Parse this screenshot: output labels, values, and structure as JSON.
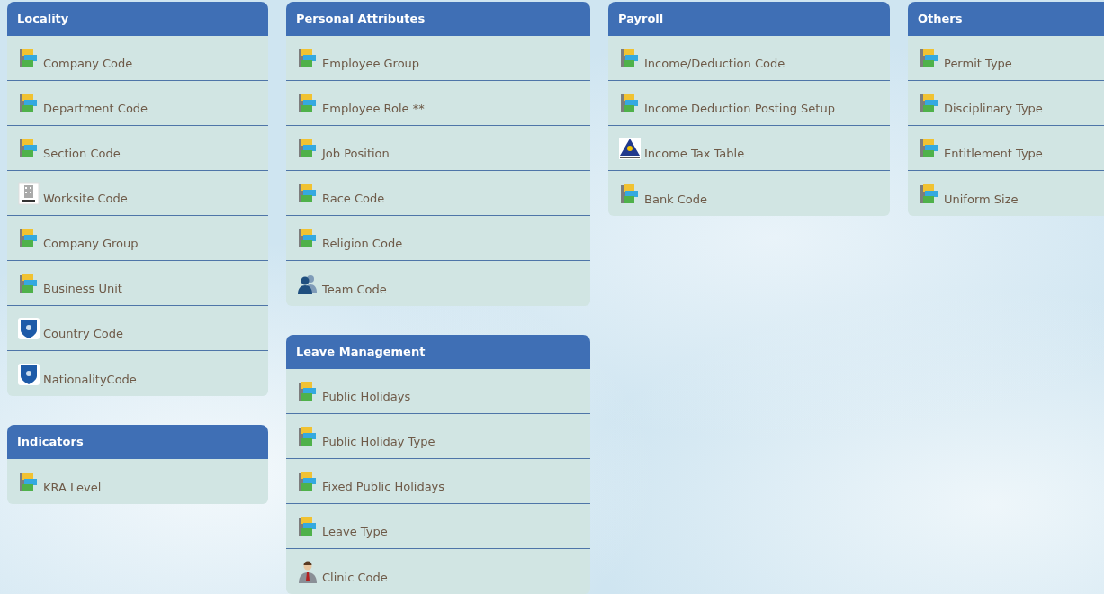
{
  "columns": [
    {
      "sections": [
        {
          "title": "Locality",
          "items": [
            {
              "label": "Company Code",
              "kind": "cabinet"
            },
            {
              "label": "Department Code",
              "kind": "cabinet"
            },
            {
              "label": "Section Code",
              "kind": "cabinet"
            },
            {
              "label": "Worksite Code",
              "kind": "office"
            },
            {
              "label": "Company Group",
              "kind": "cabinet"
            },
            {
              "label": "Business Unit",
              "kind": "cabinet"
            },
            {
              "label": "Country Code",
              "kind": "shield"
            },
            {
              "label": "NationalityCode",
              "kind": "shield"
            }
          ]
        },
        {
          "title": "Indicators",
          "items": [
            {
              "label": "KRA Level",
              "kind": "cabinet"
            }
          ]
        }
      ]
    },
    {
      "sections": [
        {
          "title": "Personal Attributes",
          "items": [
            {
              "label": "Employee Group",
              "kind": "cabinet"
            },
            {
              "label": "Employee Role **",
              "kind": "cabinet"
            },
            {
              "label": "Job Position",
              "kind": "cabinet"
            },
            {
              "label": "Race Code",
              "kind": "cabinet"
            },
            {
              "label": "Religion Code",
              "kind": "cabinet"
            },
            {
              "label": "Team Code",
              "kind": "team"
            }
          ]
        },
        {
          "title": "Leave Management",
          "items": [
            {
              "label": "Public Holidays",
              "kind": "cabinet"
            },
            {
              "label": "Public Holiday Type",
              "kind": "cabinet"
            },
            {
              "label": "Fixed Public Holidays",
              "kind": "cabinet"
            },
            {
              "label": "Leave Type",
              "kind": "cabinet"
            },
            {
              "label": "Clinic Code",
              "kind": "person"
            }
          ]
        }
      ]
    },
    {
      "sections": [
        {
          "title": "Payroll",
          "items": [
            {
              "label": "Income/Deduction Code",
              "kind": "cabinet"
            },
            {
              "label": "Income Deduction Posting Setup",
              "kind": "cabinet"
            },
            {
              "label": "Income Tax Table",
              "kind": "triangle"
            },
            {
              "label": "Bank Code",
              "kind": "cabinet"
            }
          ]
        }
      ]
    },
    {
      "sections": [
        {
          "title": "Others",
          "items": [
            {
              "label": "Permit Type",
              "kind": "cabinet"
            },
            {
              "label": "Disciplinary Type",
              "kind": "cabinet"
            },
            {
              "label": "Entitlement Type",
              "kind": "cabinet"
            },
            {
              "label": "Uniform Size",
              "kind": "cabinet"
            }
          ]
        }
      ]
    }
  ]
}
